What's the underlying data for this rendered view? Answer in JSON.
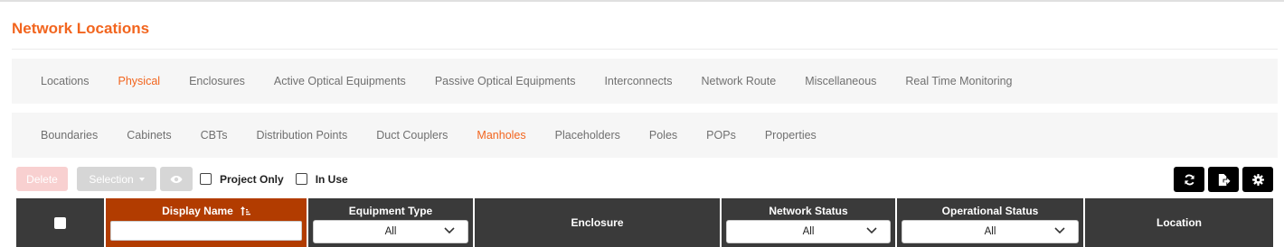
{
  "page": {
    "title": "Network Locations"
  },
  "colors": {
    "accent": "#f2651e",
    "header_bg": "#3a3a3a",
    "sorted_header_bg": "#b23c00"
  },
  "nav_primary": {
    "items": [
      "Locations",
      "Physical",
      "Enclosures",
      "Active Optical Equipments",
      "Passive Optical Equipments",
      "Interconnects",
      "Network Route",
      "Miscellaneous",
      "Real Time Monitoring"
    ],
    "active": "Physical"
  },
  "nav_secondary": {
    "items": [
      "Boundaries",
      "Cabinets",
      "CBTs",
      "Distribution Points",
      "Duct Couplers",
      "Manholes",
      "Placeholders",
      "Poles",
      "POPs",
      "Properties"
    ],
    "active": "Manholes"
  },
  "toolbar": {
    "delete_label": "Delete",
    "selection_label": "Selection",
    "project_only_label": "Project Only",
    "in_use_label": "In Use",
    "icons": [
      "eye-icon",
      "refresh-icon",
      "export-icon",
      "gear-icon"
    ]
  },
  "table": {
    "columns": {
      "display_name": "Display Name",
      "equipment_type": "Equipment Type",
      "enclosure": "Enclosure",
      "network_status": "Network Status",
      "operational_status": "Operational Status",
      "location": "Location"
    },
    "filters": {
      "equipment_type": "All",
      "network_status": "All",
      "operational_status": "All"
    },
    "sorted_column": "Display Name",
    "sort_direction": "ascending"
  }
}
